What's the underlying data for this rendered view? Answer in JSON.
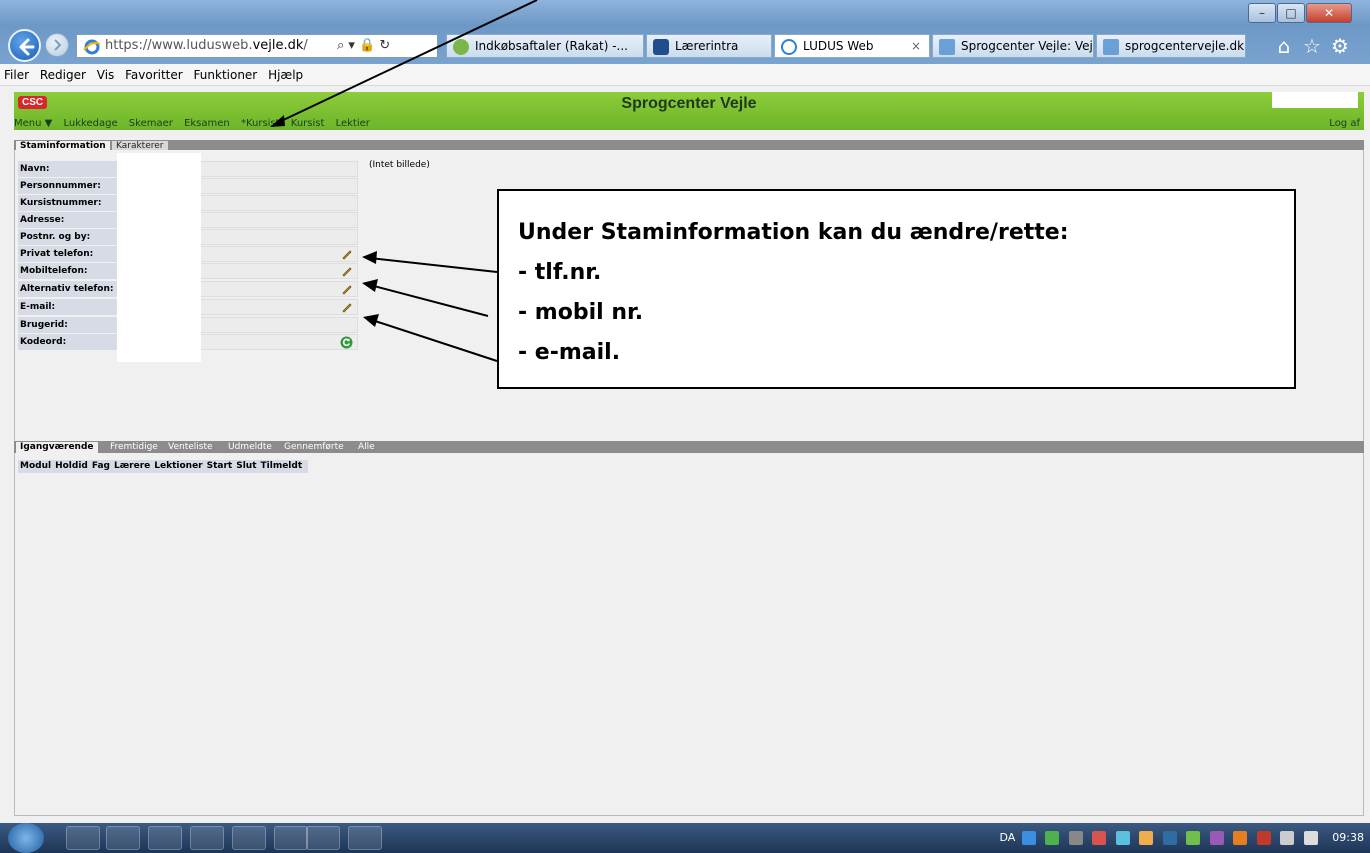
{
  "browser": {
    "url_prefix": "https://www.ludusweb.",
    "url_domain": "vejle.dk",
    "url_suffix": "/",
    "address_tools": "⌕ ▾ 🔒 ↻",
    "tabs": [
      {
        "label": "Indkøbsaftaler (Rakat) -..."
      },
      {
        "label": "Lærerintra"
      },
      {
        "label": "LUDUS Web",
        "close": "×"
      },
      {
        "label": "Sprogcenter Vejle: Vejl..."
      },
      {
        "label": "sprogcentervejle.dk"
      }
    ],
    "window_controls": {
      "minimize": "–",
      "maximize": "□",
      "close": "✕"
    },
    "nav_icons": {
      "home": "⌂",
      "favorites": "☆",
      "tools": "⚙"
    }
  },
  "menubar": [
    "Filer",
    "Rediger",
    "Vis",
    "Favoritter",
    "Funktioner",
    "Hjælp"
  ],
  "ludus": {
    "logo": "CSC",
    "title": "Sprogcenter Vejle",
    "nav": [
      "Menu ▼",
      "Lukkedage",
      "Skemaer",
      "Eksamen",
      "*Kursist",
      "Kursist",
      "Lektier"
    ],
    "logout": "Log af"
  },
  "tabs_top": [
    {
      "label": "Staminformation",
      "active": true
    },
    {
      "label": "Karakterer",
      "active": false
    }
  ],
  "info": {
    "fields": [
      {
        "label": "Navn:",
        "editable": false
      },
      {
        "label": "Personnummer:",
        "editable": false
      },
      {
        "label": "Kursistnummer:",
        "editable": false
      },
      {
        "label": "Adresse:",
        "editable": false
      },
      {
        "label": "Postnr. og by:",
        "editable": false
      },
      {
        "label": "Privat telefon:",
        "editable": true
      },
      {
        "label": "Mobiltelefon:",
        "editable": true
      },
      {
        "label": "Alternativ telefon:",
        "editable": true
      },
      {
        "label": "E-mail:",
        "editable": true
      },
      {
        "label": "Brugerid:",
        "editable": false
      },
      {
        "label": "Kodeord:",
        "editable": false,
        "refresh": true
      }
    ],
    "no_image": "(Intet billede)"
  },
  "callout": {
    "line1": "Under Staminformation kan du ændre/rette:",
    "line2": "- tlf.nr.",
    "line3": "- mobil nr.",
    "line4": "- e-mail."
  },
  "tabs_bottom": [
    {
      "label": "Igangværende",
      "active": true
    },
    {
      "label": "Fremtidige",
      "active": false
    },
    {
      "label": "Venteliste",
      "active": false
    },
    {
      "label": "Udmeldte",
      "active": false
    },
    {
      "label": "Gennemførte",
      "active": false
    },
    {
      "label": "Alle",
      "active": false
    }
  ],
  "course_columns": [
    "Modul",
    "Holdid",
    "Fag",
    "Lærere",
    "Lektioner",
    "Start",
    "Slut",
    "Tilmeldt"
  ],
  "taskbar": {
    "language": "DA",
    "time": "09:38"
  }
}
